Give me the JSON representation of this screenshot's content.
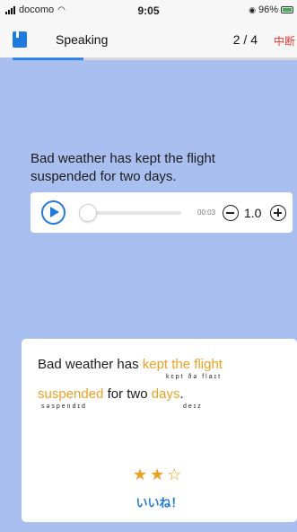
{
  "status_bar": {
    "carrier": "docomo",
    "time": "9:05",
    "battery": "96%"
  },
  "header": {
    "title": "Speaking",
    "progress_text": "2 / 4",
    "quit_label": "中断",
    "progress": 0.25
  },
  "prompt": {
    "sentence": "Bad weather has kept the flight suspended for two days."
  },
  "player": {
    "elapsed": "00:03",
    "speed": "1.0",
    "position": 0.0
  },
  "result": {
    "line1": {
      "plain": "Bad weather has ",
      "highlight": "kept the flight"
    },
    "ipa1": "kɛpt  ðə   flaɪt",
    "line2": {
      "highlight1": "suspended",
      "plain": " for two ",
      "highlight2": "days",
      "end": "."
    },
    "ipa2a": "səspendɪd",
    "ipa2b": "deɪz",
    "rating": 2,
    "rating_max": 3,
    "feedback": "いいね！"
  },
  "colors": {
    "background": "#a9bff0",
    "accent": "#1f7ae0",
    "highlight": "#f0a020",
    "quit": "#e53935"
  }
}
